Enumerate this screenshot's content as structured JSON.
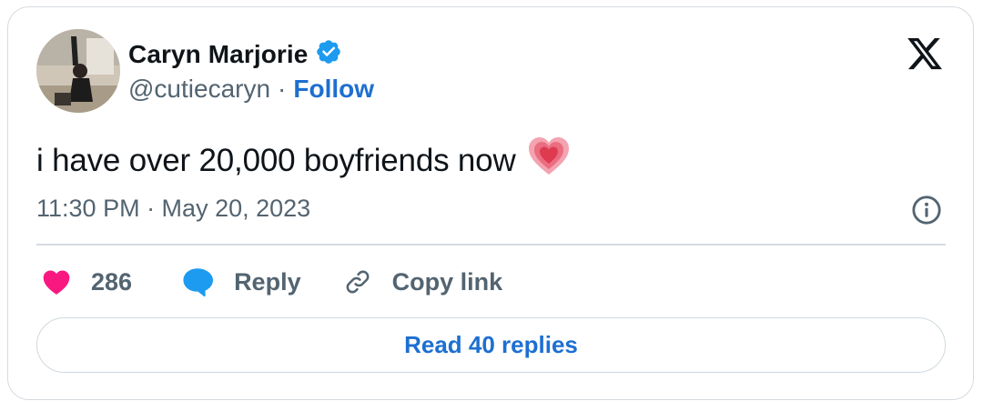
{
  "author": {
    "display_name": "Caryn Marjorie",
    "handle": "@cutiecaryn",
    "separator": "·",
    "follow_label": "Follow",
    "verified_icon": "verified-badge-icon"
  },
  "tweet": {
    "text": "i have over 20,000 boyfriends now",
    "emoji_icon": "heart-emoji-icon",
    "timestamp": "11:30 PM · May 20, 2023"
  },
  "actions": {
    "like_count": "286",
    "reply_label": "Reply",
    "copy_link_label": "Copy link"
  },
  "footer": {
    "read_replies_label": "Read 40 replies"
  },
  "colors": {
    "link": "#1d6fd1",
    "like": "#f91880",
    "reply": "#1d9bf0",
    "muted": "#536471",
    "border": "#d5dbe0"
  }
}
